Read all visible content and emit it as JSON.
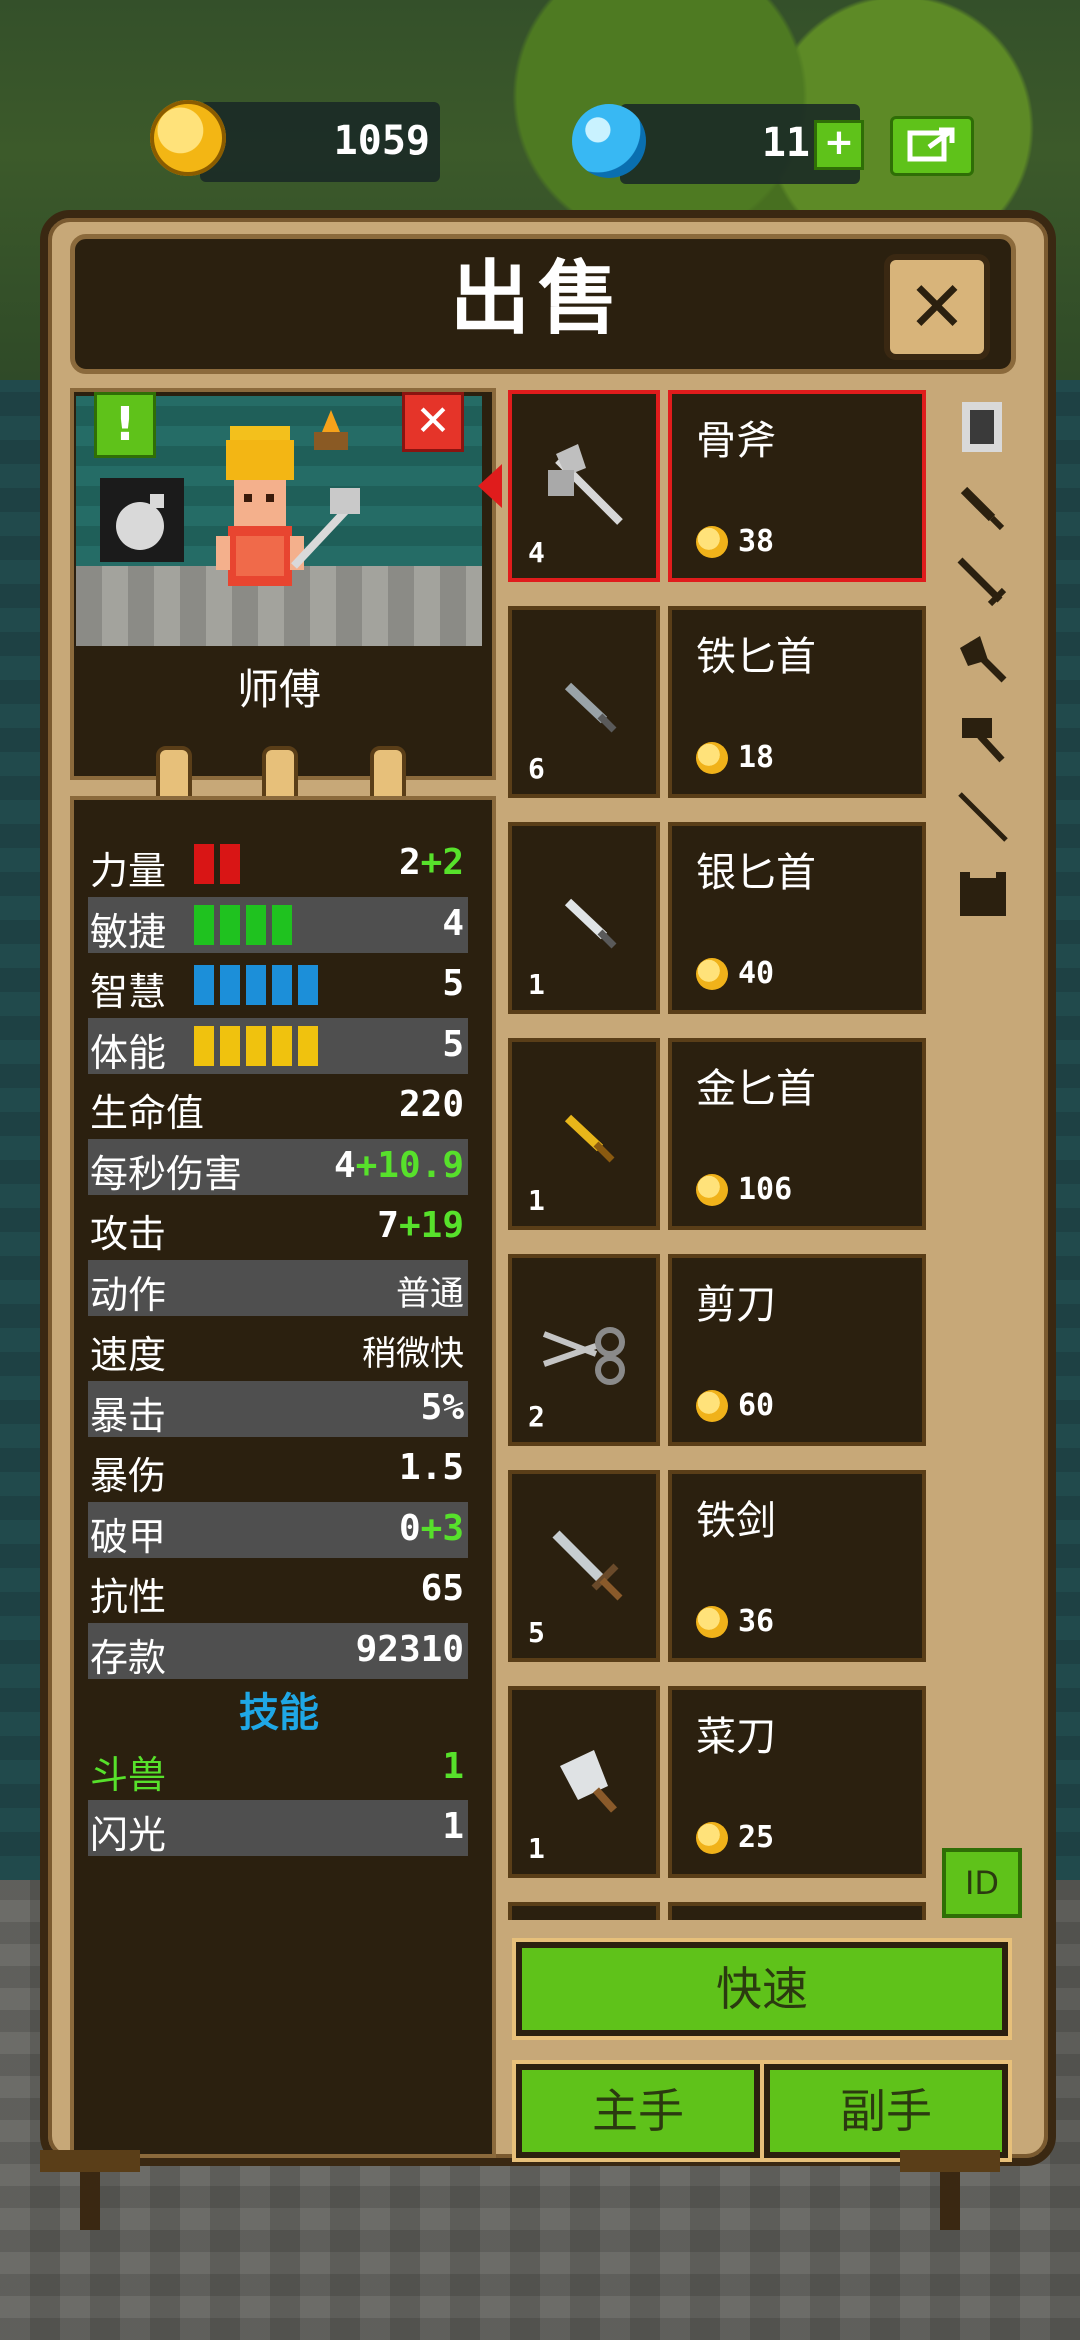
{
  "currency": {
    "coins": "1059",
    "gems": "11",
    "plus": "+"
  },
  "dialog": {
    "title": "出售",
    "close_glyph": "✕"
  },
  "hero": {
    "name": "师傅",
    "excl": "!",
    "dismiss": "✕"
  },
  "stats": [
    {
      "label": "力量",
      "base": "2",
      "bonus": "+2",
      "bar_count": 2,
      "bar_color": "#d91515"
    },
    {
      "label": "敏捷",
      "base": "4",
      "bonus": "",
      "bar_count": 4,
      "bar_color": "#1fc21f"
    },
    {
      "label": "智慧",
      "base": "5",
      "bonus": "",
      "bar_count": 5,
      "bar_color": "#1c8fd9"
    },
    {
      "label": "体能",
      "base": "5",
      "bonus": "",
      "bar_count": 5,
      "bar_color": "#f0c20e"
    },
    {
      "label": "生命值",
      "base": "220",
      "bonus": ""
    },
    {
      "label": "每秒伤害",
      "base": "4",
      "bonus": "+10.9"
    },
    {
      "label": "攻击",
      "base": "7",
      "bonus": "+19"
    },
    {
      "label": "动作",
      "base": "普通",
      "bonus": ""
    },
    {
      "label": "速度",
      "base": "稍微快",
      "bonus": ""
    },
    {
      "label": "暴击",
      "base": "5%",
      "bonus": ""
    },
    {
      "label": "暴伤",
      "base": "1.5",
      "bonus": ""
    },
    {
      "label": "破甲",
      "base": "0",
      "bonus": "+3"
    },
    {
      "label": "抗性",
      "base": "65",
      "bonus": ""
    },
    {
      "label": "存款",
      "base": "92310",
      "bonus": ""
    }
  ],
  "skills": {
    "header": "技能",
    "list": [
      {
        "label": "斗兽",
        "value": "1",
        "highlight": true
      },
      {
        "label": "闪光",
        "value": "1",
        "highlight": false
      }
    ]
  },
  "items": [
    {
      "name": "骨斧",
      "count": "4",
      "price": "38",
      "icon": "axe-icon",
      "selected": true
    },
    {
      "name": "铁匕首",
      "count": "6",
      "price": "18",
      "icon": "iron-dagger-icon",
      "selected": false
    },
    {
      "name": "银匕首",
      "count": "1",
      "price": "40",
      "icon": "silver-dagger-icon",
      "selected": false
    },
    {
      "name": "金匕首",
      "count": "1",
      "price": "106",
      "icon": "gold-dagger-icon",
      "selected": false
    },
    {
      "name": "剪刀",
      "count": "2",
      "price": "60",
      "icon": "scissors-icon",
      "selected": false
    },
    {
      "name": "铁剑",
      "count": "5",
      "price": "36",
      "icon": "iron-sword-icon",
      "selected": false
    },
    {
      "name": "菜刀",
      "count": "1",
      "price": "25",
      "icon": "cleaver-icon",
      "selected": false
    }
  ],
  "categories": [
    "all-icon",
    "dagger-icon",
    "sword-icon",
    "axe-category-icon",
    "hammer-icon",
    "spear-icon",
    "armor-icon"
  ],
  "buttons": {
    "id": "ID",
    "quick": "快速",
    "main_hand": "主手",
    "off_hand": "副手"
  },
  "colors": {
    "green_button": "#5fc21a",
    "panel": "#c7a878",
    "dark": "#2b200f",
    "bonus_green": "#57e12b",
    "skill_blue": "#1fa7e6",
    "select_red": "#e01c1c"
  }
}
